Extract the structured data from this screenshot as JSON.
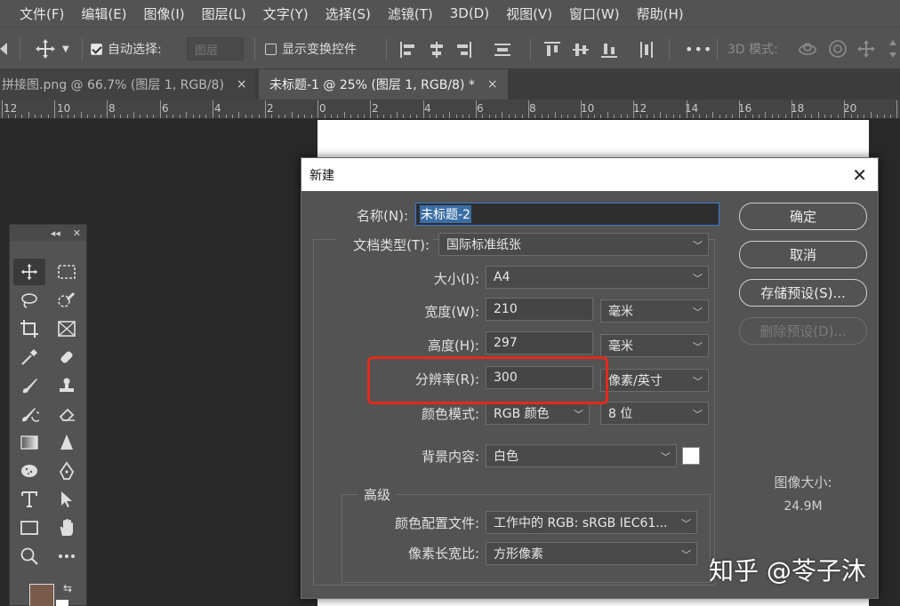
{
  "menubar": [
    "文件(F)",
    "编辑(E)",
    "图像(I)",
    "图层(L)",
    "文字(Y)",
    "选择(S)",
    "滤镜(T)",
    "3D(D)",
    "视图(V)",
    "窗口(W)",
    "帮助(H)"
  ],
  "options_bar": {
    "auto_select_label": "自动选择:",
    "auto_select_target": "图层",
    "show_transform_label": "显示变换控件",
    "more": "•••",
    "mode_3d_label": "3D 模式:"
  },
  "tabs": [
    {
      "label": "拼接图.png @ 66.7% (图层 1, RGB/8)",
      "close": "×"
    },
    {
      "label": "未标题-1 @ 25% (图层 1, RGB/8) *",
      "close": "×"
    }
  ],
  "ruler_labels": [
    "12",
    "10",
    "8",
    "6",
    "4",
    "2",
    "0",
    "2",
    "4",
    "6",
    "8",
    "10",
    "12",
    "14",
    "16",
    "18",
    "20"
  ],
  "dialog": {
    "title": "新建",
    "close": "✕",
    "name_label": "名称(N):",
    "name_value": "未标题-2",
    "doc_type_label": "文档类型(T):",
    "doc_type_value": "国际标准纸张",
    "size_label": "大小(I):",
    "size_value": "A4",
    "width_label": "宽度(W):",
    "width_value": "210",
    "width_unit": "毫米",
    "height_label": "高度(H):",
    "height_value": "297",
    "height_unit": "毫米",
    "resolution_label": "分辨率(R):",
    "resolution_value": "300",
    "resolution_unit": "像素/英寸",
    "color_mode_label": "颜色模式:",
    "color_mode_value": "RGB 颜色",
    "bit_depth_value": "8 位",
    "bg_label": "背景内容:",
    "bg_value": "白色",
    "advanced_title": "高级",
    "profile_label": "颜色配置文件:",
    "profile_value": "工作中的 RGB: sRGB IEC61...",
    "aspect_label": "像素长宽比:",
    "aspect_value": "方形像素",
    "buttons": {
      "ok": "确定",
      "cancel": "取消",
      "save_preset": "存储预设(S)...",
      "delete_preset": "删除预设(D)..."
    },
    "image_size_label": "图像大小:",
    "image_size_value": "24.9M"
  },
  "watermark": "知乎 @苓子沐"
}
